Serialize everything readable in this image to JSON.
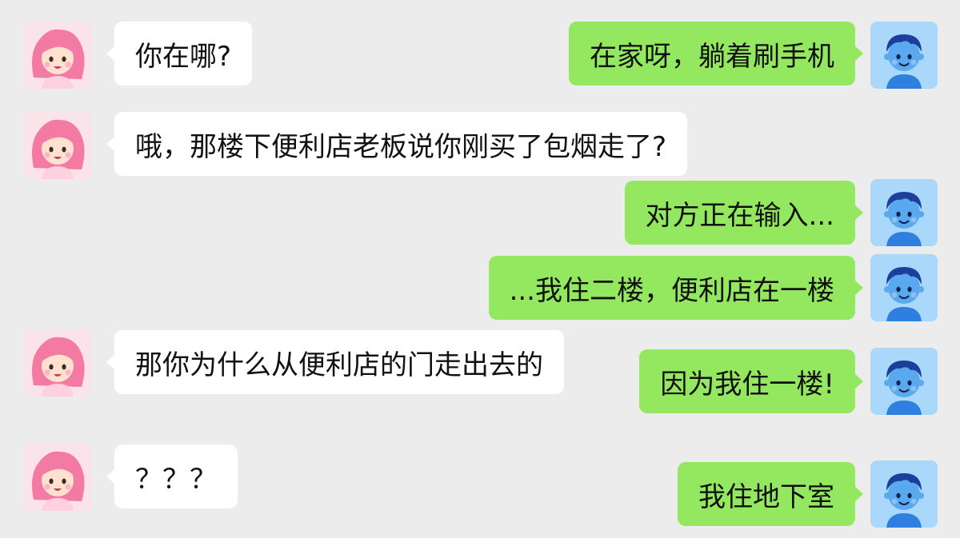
{
  "colors": {
    "background": "#ececec",
    "incoming_bubble": "#ffffff",
    "outgoing_bubble": "#93e85f",
    "girl_avatar_bg": "#fbe3ea",
    "boy_avatar_bg": "#a9d8fb"
  },
  "avatars": {
    "incoming": "girl-avatar-icon",
    "outgoing": "boy-avatar-icon"
  },
  "messages": [
    {
      "side": "left",
      "text": "你在哪?"
    },
    {
      "side": "right",
      "text": "在家呀，躺着刷手机"
    },
    {
      "side": "left",
      "text": "哦，那楼下便利店老板说你刚买了包烟走了?"
    },
    {
      "side": "right",
      "text": "对方正在输入..."
    },
    {
      "side": "right",
      "text": "...我住二楼，便利店在一楼"
    },
    {
      "side": "left",
      "text": "那你为什么从便利店的门走出去的"
    },
    {
      "side": "right",
      "text": "因为我住一楼!"
    },
    {
      "side": "left",
      "text": "？？？"
    },
    {
      "side": "right",
      "text": "我住地下室"
    }
  ]
}
